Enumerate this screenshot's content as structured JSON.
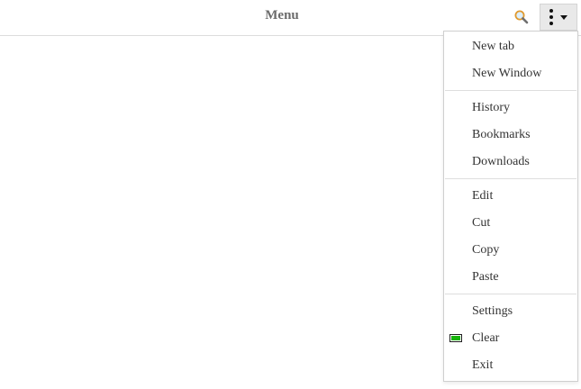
{
  "toolbar": {
    "title": "Menu",
    "search_icon": "search-icon",
    "menu_icon": "kebab-menu-icon"
  },
  "menu": {
    "groups": [
      {
        "items": [
          {
            "label": "New tab"
          },
          {
            "label": "New Window"
          }
        ]
      },
      {
        "items": [
          {
            "label": "History"
          },
          {
            "label": "Bookmarks"
          },
          {
            "label": "Downloads"
          }
        ]
      },
      {
        "items": [
          {
            "label": "Edit"
          },
          {
            "label": "Cut"
          },
          {
            "label": "Copy"
          },
          {
            "label": "Paste"
          }
        ]
      },
      {
        "items": [
          {
            "label": "Settings"
          },
          {
            "label": "Clear",
            "icon": "clear-icon"
          },
          {
            "label": "Exit"
          }
        ]
      }
    ]
  },
  "colors": {
    "title": "#6b6b6b",
    "clear_icon_fill": "#17b30b",
    "search_icon": "#e09a2f"
  }
}
